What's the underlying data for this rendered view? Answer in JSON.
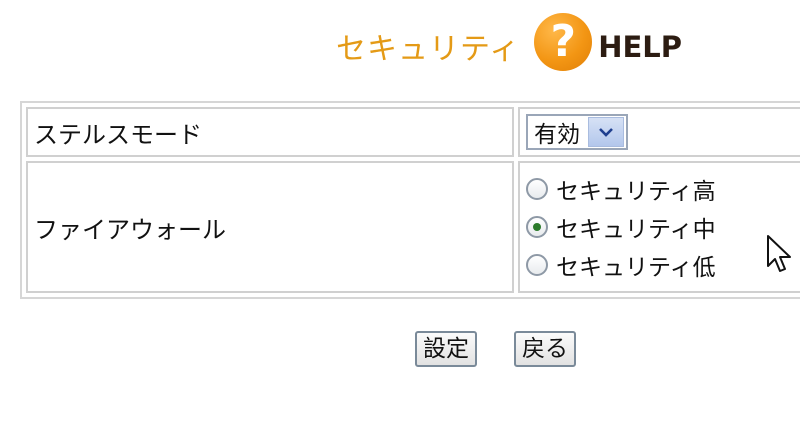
{
  "header": {
    "title": "セキュリティ",
    "help_icon_glyph": "?",
    "help_label": "HELP",
    "title_color": "#e49a16",
    "help_icon_color": "#f39614"
  },
  "settings": {
    "stealth_mode": {
      "label": "ステルスモード",
      "selected": "有効"
    },
    "firewall": {
      "label": "ファイアウォール",
      "options": [
        {
          "label": "セキュリティ高",
          "checked": false
        },
        {
          "label": "セキュリティ中",
          "checked": true
        },
        {
          "label": "セキュリティ低",
          "checked": false
        }
      ]
    }
  },
  "buttons": {
    "apply_label": "設定",
    "back_label": "戻る"
  }
}
